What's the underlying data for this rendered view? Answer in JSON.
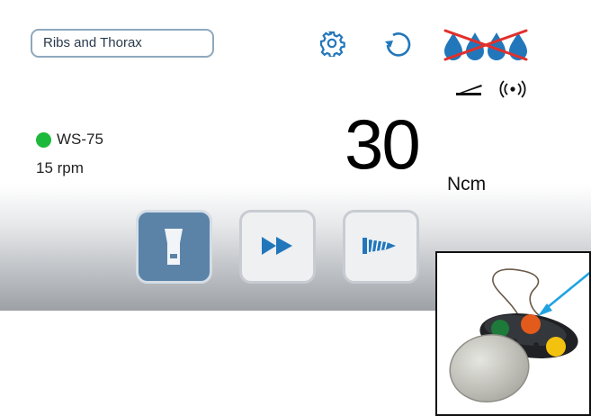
{
  "header": {
    "preset_value": "Ribs and Thorax",
    "icons": [
      "gear-icon",
      "rotation-direction-icon",
      "irrigation-off-icon",
      "foot-pedal-icon",
      "wireless-icon"
    ]
  },
  "status": {
    "device": "WS-75",
    "speed": "15 rpm",
    "indicator_color": "#1db93a"
  },
  "torque": {
    "value": "30",
    "unit": "Ncm"
  },
  "modes": {
    "buttons": [
      {
        "name": "handpiece-mode",
        "icon": "handpiece-icon",
        "selected": true
      },
      {
        "name": "fast-forward-mode",
        "icon": "fast-forward-icon",
        "selected": false
      },
      {
        "name": "screw-mode",
        "icon": "screw-icon",
        "selected": false
      }
    ]
  },
  "colors": {
    "accent_blue": "#2277bb",
    "selected_button": "#5b83a8",
    "irrigation_cross": "#e0302c"
  },
  "inset": {
    "subject": "wireless-foot-control-photo",
    "arrow_color": "#1fa3e0"
  }
}
